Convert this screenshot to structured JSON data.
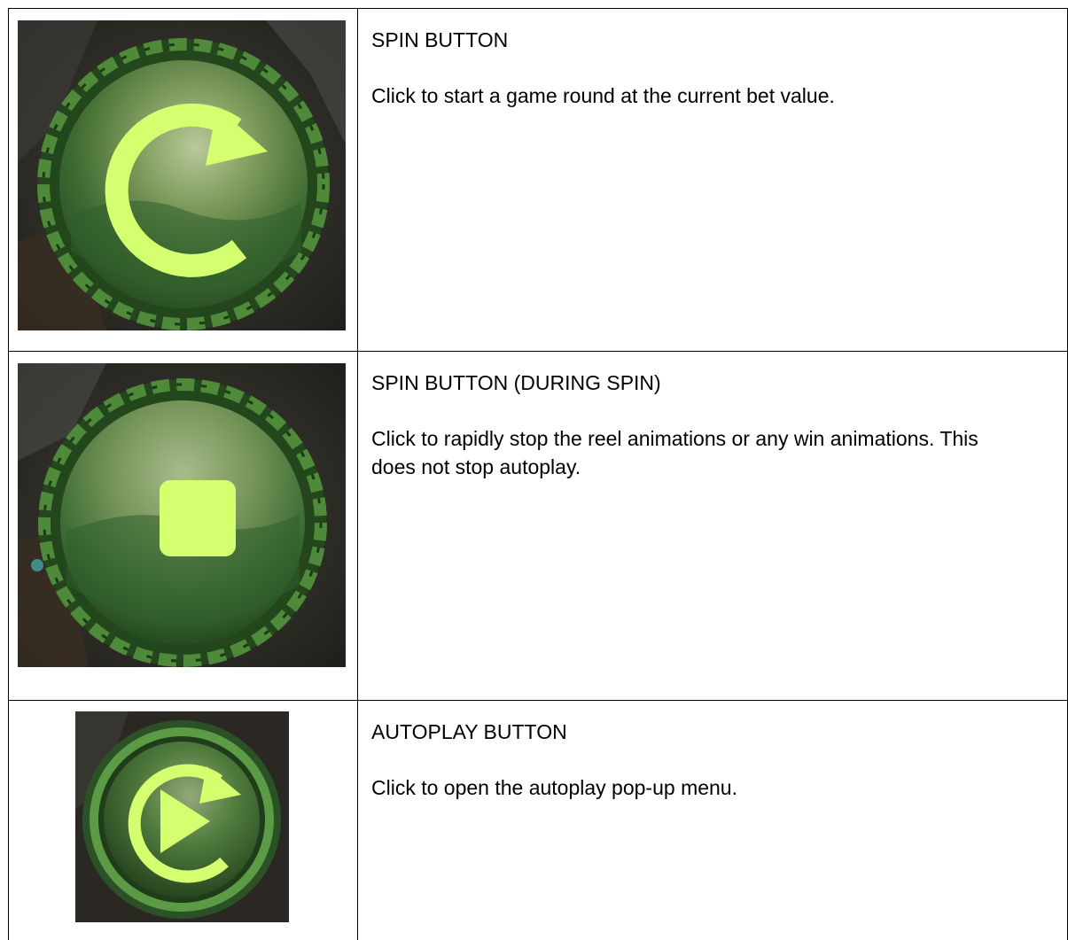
{
  "rows": [
    {
      "title": "SPIN BUTTON",
      "description": "Click to start a game round at the current bet value.",
      "icon": "spin-arrow-icon"
    },
    {
      "title": "SPIN BUTTON (DURING SPIN)",
      "description": "Click to rapidly stop the reel animations or any win animations. This does not stop autoplay.",
      "icon": "stop-square-icon"
    },
    {
      "title": "AUTOPLAY BUTTON",
      "description": "Click to open the autoplay pop-up menu.",
      "icon": "autoplay-icon"
    }
  ],
  "colors": {
    "icon_accent": "#d4ff6e",
    "button_green": "#3f6b32",
    "braid_green": "#2f5a24",
    "background_dark": "#2e2a24"
  }
}
